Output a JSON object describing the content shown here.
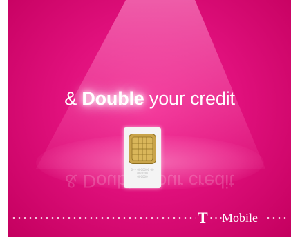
{
  "ad": {
    "headline_prefix": "& ",
    "headline_emphasis": "Double",
    "headline_suffix": " your credit",
    "headline_full": "& Double your credit",
    "sim_print": [
      "0 ··· 0000000 00",
      "000000",
      "000000"
    ],
    "brand_t": "T",
    "brand_name": "Mobile",
    "colors": {
      "magenta": "#e0107c",
      "beam": "#ff8cc8",
      "text": "#ffffff",
      "chip_gold": "#c9a44a"
    },
    "icons": [
      "spotlight",
      "sim-card",
      "sim-chip",
      "t-mobile-logo"
    ]
  }
}
